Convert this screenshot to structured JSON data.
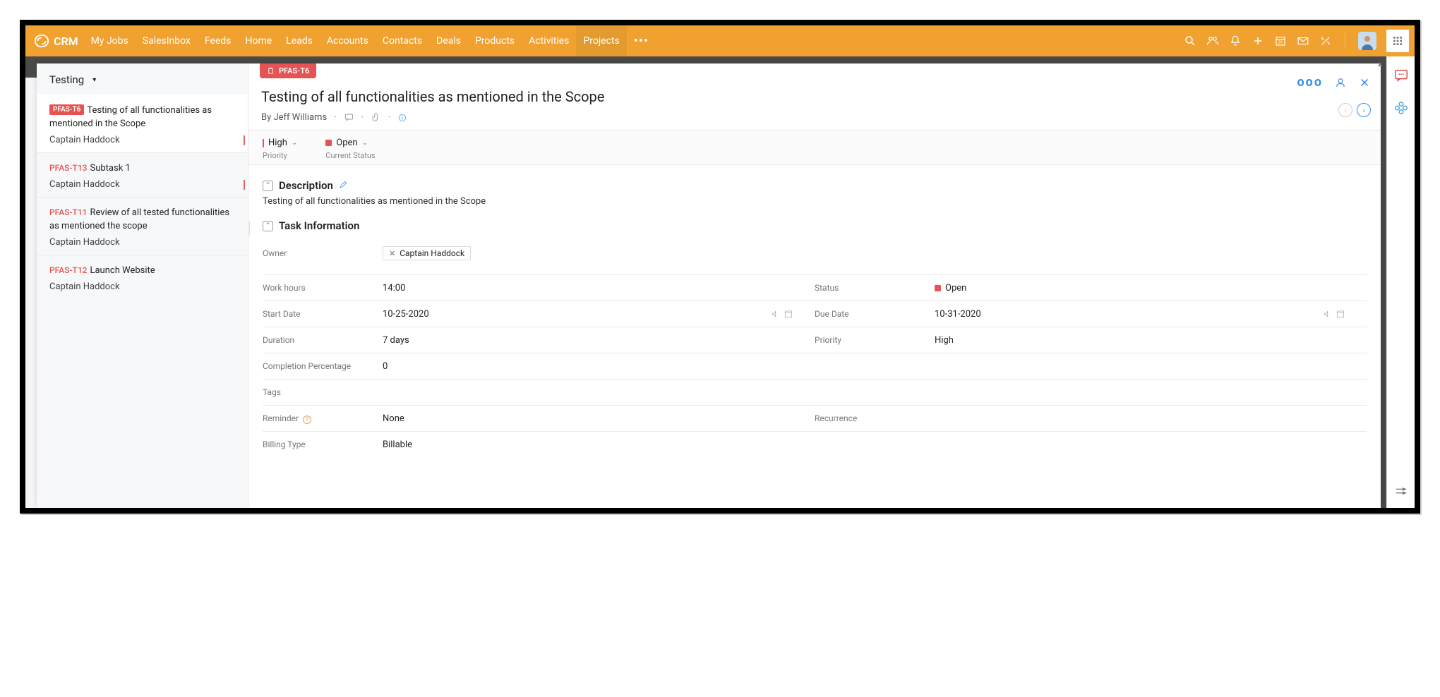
{
  "nav": {
    "brand": "CRM",
    "items": [
      "My Jobs",
      "SalesInbox",
      "Feeds",
      "Home",
      "Leads",
      "Accounts",
      "Contacts",
      "Deals",
      "Products",
      "Activities",
      "Projects"
    ],
    "active_index": 10,
    "more": "•••"
  },
  "sidebar": {
    "title": "Testing",
    "items": [
      {
        "id": "PFAS-T6",
        "title": "Testing of all functionalities as mentioned in the Scope",
        "assignee": "Captain Haddock",
        "selected": true,
        "red_bar": true,
        "badge": true
      },
      {
        "id": "PFAS-T13",
        "title": "Subtask 1",
        "assignee": "Captain Haddock",
        "selected": false,
        "red_bar": true,
        "badge": false
      },
      {
        "id": "PFAS-T11",
        "title": "Review of all tested functionalities as mentioned the scope",
        "assignee": "Captain Haddock",
        "selected": false,
        "red_bar": false,
        "badge": false
      },
      {
        "id": "PFAS-T12",
        "title": "Launch Website",
        "assignee": "Captain Haddock",
        "selected": false,
        "red_bar": false,
        "badge": false
      }
    ]
  },
  "detail": {
    "badge_id": "PFAS-T6",
    "title": "Testing of all functionalities as mentioned in the Scope",
    "author": "By Jeff Williams",
    "priority": "High",
    "priority_label": "Priority",
    "status": "Open",
    "status_label": "Current Status",
    "description_header": "Description",
    "description_text": "Testing of all functionalities as mentioned in the Scope",
    "task_info_header": "Task Information",
    "owner_label": "Owner",
    "owner_value": "Captain Haddock",
    "rows": {
      "work_hours_k": "Work hours",
      "work_hours_v": "14:00",
      "status_k": "Status",
      "status_v": "Open",
      "start_date_k": "Start Date",
      "start_date_v": "10-25-2020",
      "due_date_k": "Due Date",
      "due_date_v": "10-31-2020",
      "duration_k": "Duration",
      "duration_v": "7 days",
      "priority_k": "Priority",
      "priority_v": "High",
      "completion_k": "Completion Percentage",
      "completion_v": "0",
      "tags_k": "Tags",
      "tags_v": "",
      "reminder_k": "Reminder",
      "reminder_v": "None",
      "recurrence_k": "Recurrence",
      "recurrence_v": "",
      "billing_k": "Billing Type",
      "billing_v": "Billable"
    },
    "actions_dots": "ooo"
  }
}
